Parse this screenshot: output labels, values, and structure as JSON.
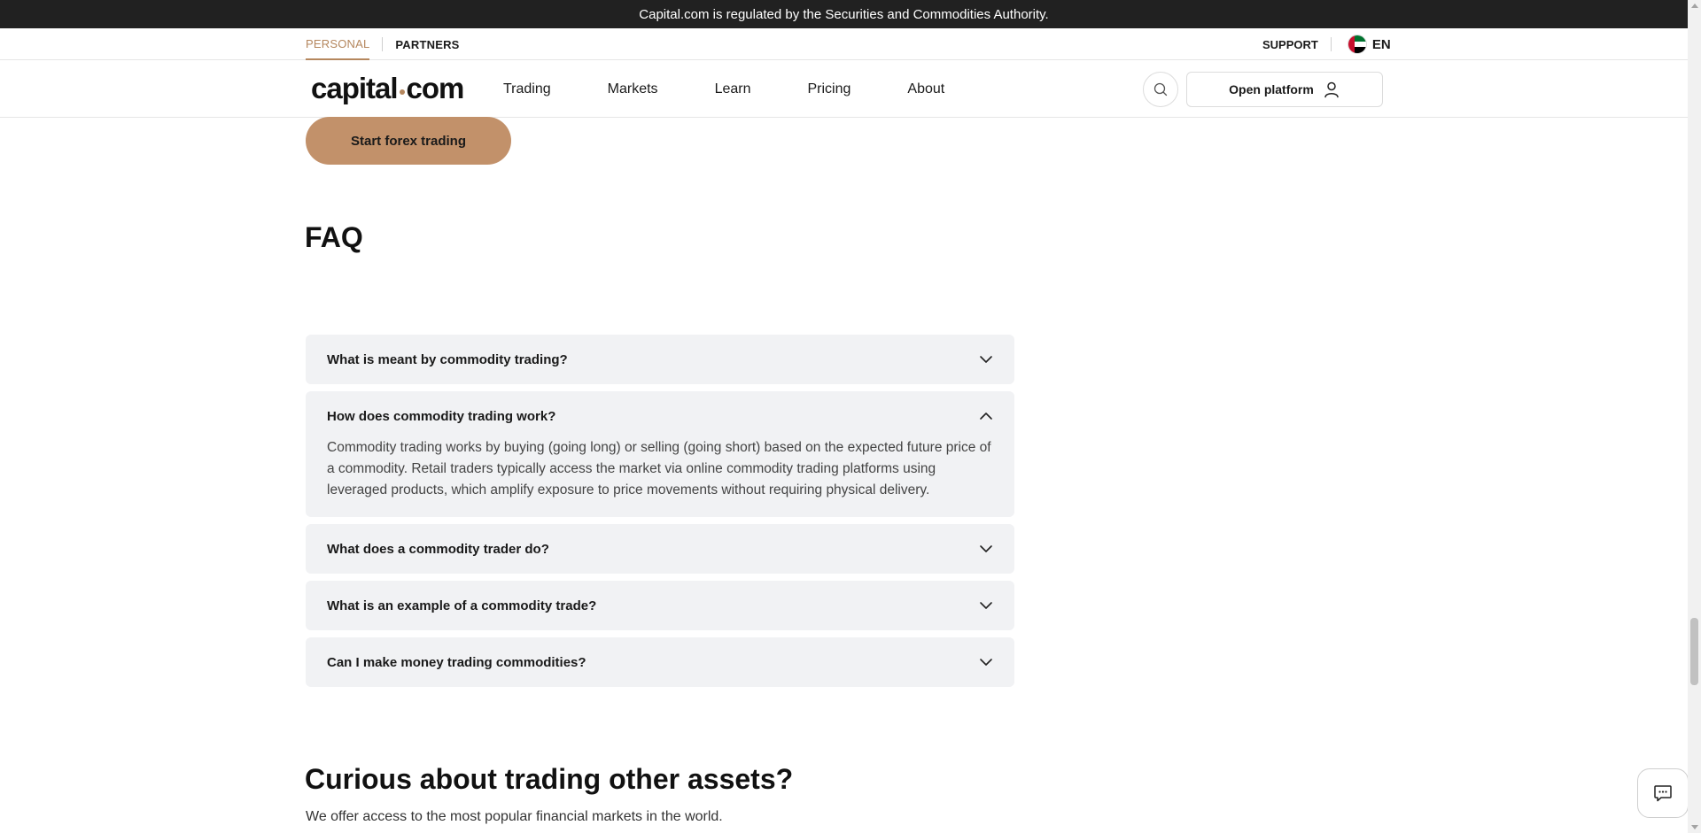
{
  "regulation_bar": {
    "text": "Capital.com is regulated by the Securities and Commodities Authority."
  },
  "sub_nav": {
    "tabs": [
      {
        "label": "PERSONAL",
        "active": true
      },
      {
        "label": "PARTNERS",
        "active": false
      }
    ],
    "support_label": "SUPPORT",
    "language": {
      "code": "EN",
      "flag_icon": "uae-flag-icon"
    }
  },
  "main_nav": {
    "logo": {
      "part1": "capital",
      "part2": "com"
    },
    "links": [
      "Trading",
      "Markets",
      "Learn",
      "Pricing",
      "About"
    ],
    "search_icon": "search-icon",
    "open_platform_label": "Open platform",
    "user_icon": "user-icon"
  },
  "cta": {
    "label": "Start forex trading"
  },
  "faq": {
    "title": "FAQ",
    "items": [
      {
        "question": "What is meant by commodity trading?",
        "expanded": false,
        "answer": ""
      },
      {
        "question": "How does commodity trading work?",
        "expanded": true,
        "answer": "Commodity trading works by buying (going long) or selling (going short) based on the expected future price of a commodity. Retail traders typically access the market via online commodity trading platforms using leveraged products, which amplify exposure to price movements without requiring physical delivery."
      },
      {
        "question": "What does a commodity trader do?",
        "expanded": false,
        "answer": ""
      },
      {
        "question": "What is an example of a commodity trade?",
        "expanded": false,
        "answer": ""
      },
      {
        "question": "Can I make money trading commodities?",
        "expanded": false,
        "answer": ""
      }
    ]
  },
  "other_assets": {
    "title": "Curious about trading other assets?",
    "subtitle": "We offer access to the most popular financial markets in the world."
  },
  "chat": {
    "icon": "chat-icon"
  },
  "colors": {
    "accent": "#b5875e",
    "cta_bg": "#c2916a",
    "faq_bg": "#f1f2f4",
    "top_bar": "#212121"
  }
}
